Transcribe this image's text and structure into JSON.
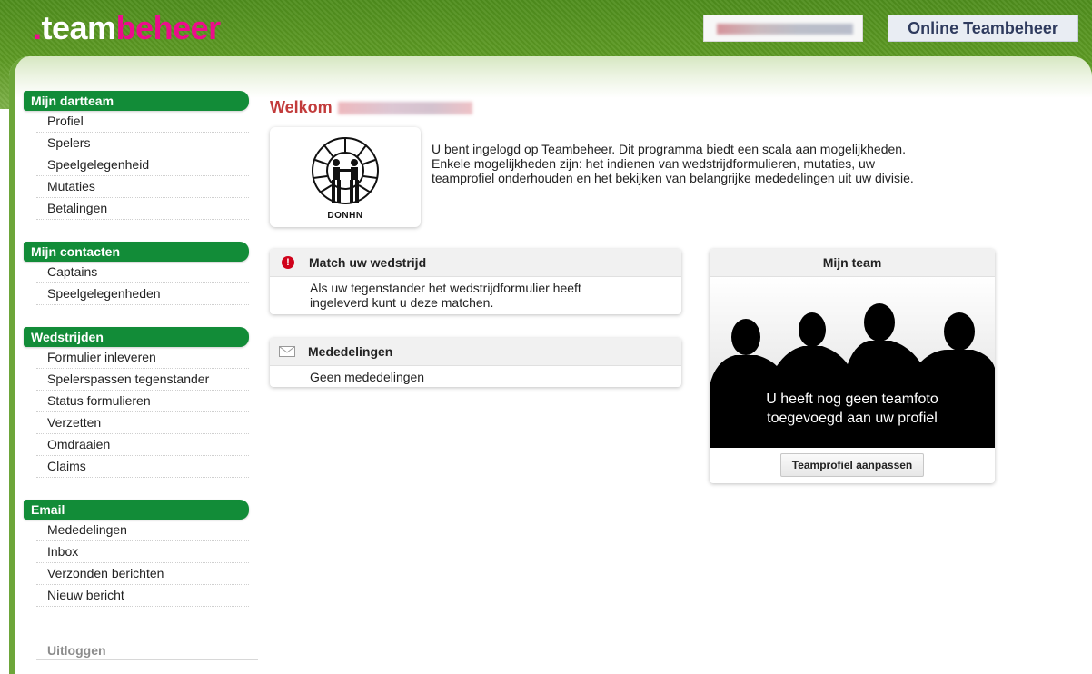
{
  "header": {
    "logo_dot": ".",
    "logo_team": "team",
    "logo_beheer": "beheer",
    "brand_button": "Online Teambeheer",
    "user_name_blurred": ""
  },
  "sidebar": {
    "sections": [
      {
        "title": "Mijn dartteam",
        "items": [
          "Profiel",
          "Spelers",
          "Speelgelegenheid",
          "Mutaties",
          "Betalingen"
        ]
      },
      {
        "title": "Mijn contacten",
        "items": [
          "Captains",
          "Speelgelegenheden"
        ]
      },
      {
        "title": "Wedstrijden",
        "items": [
          "Formulier inleveren",
          "Spelerspassen tegenstander",
          "Status formulieren",
          "Verzetten",
          "Omdraaien",
          "Claims"
        ]
      },
      {
        "title": "Email",
        "items": [
          "Mededelingen",
          "Inbox",
          "Verzonden berichten",
          "Nieuw bericht"
        ]
      }
    ],
    "logout": "Uitloggen"
  },
  "main": {
    "welcome": "Welkom",
    "logo_text": "DONHN",
    "intro_lines": [
      "U bent ingelogd op Teambeheer. Dit programma biedt een scala aan mogelijkheden.",
      "Enkele mogelijkheden zijn: het indienen van wedstrijdformulieren, mutaties, uw",
      "teamprofiel onderhouden en het bekijken van belangrijke mededelingen uit uw divisie."
    ],
    "match_card": {
      "title": "Match uw wedstrijd",
      "icon": "!",
      "body_lines": [
        "Als uw tegenstander het wedstrijdformulier heeft",
        "ingeleverd kunt u deze matchen."
      ]
    },
    "news_card": {
      "title": "Mededelingen",
      "body": "Geen mededelingen"
    },
    "team_card": {
      "title": "Mijn team",
      "photo_text_lines": [
        "U heeft nog geen teamfoto",
        "toegevoegd aan uw profiel"
      ],
      "button": "Teamprofiel aanpassen"
    }
  },
  "colors": {
    "header_green": "#5d9a23",
    "section_green": "#128c38",
    "logo_pink": "#ec0d8c",
    "welcome_red": "#c23b3b",
    "alert_red": "#d0021b"
  }
}
